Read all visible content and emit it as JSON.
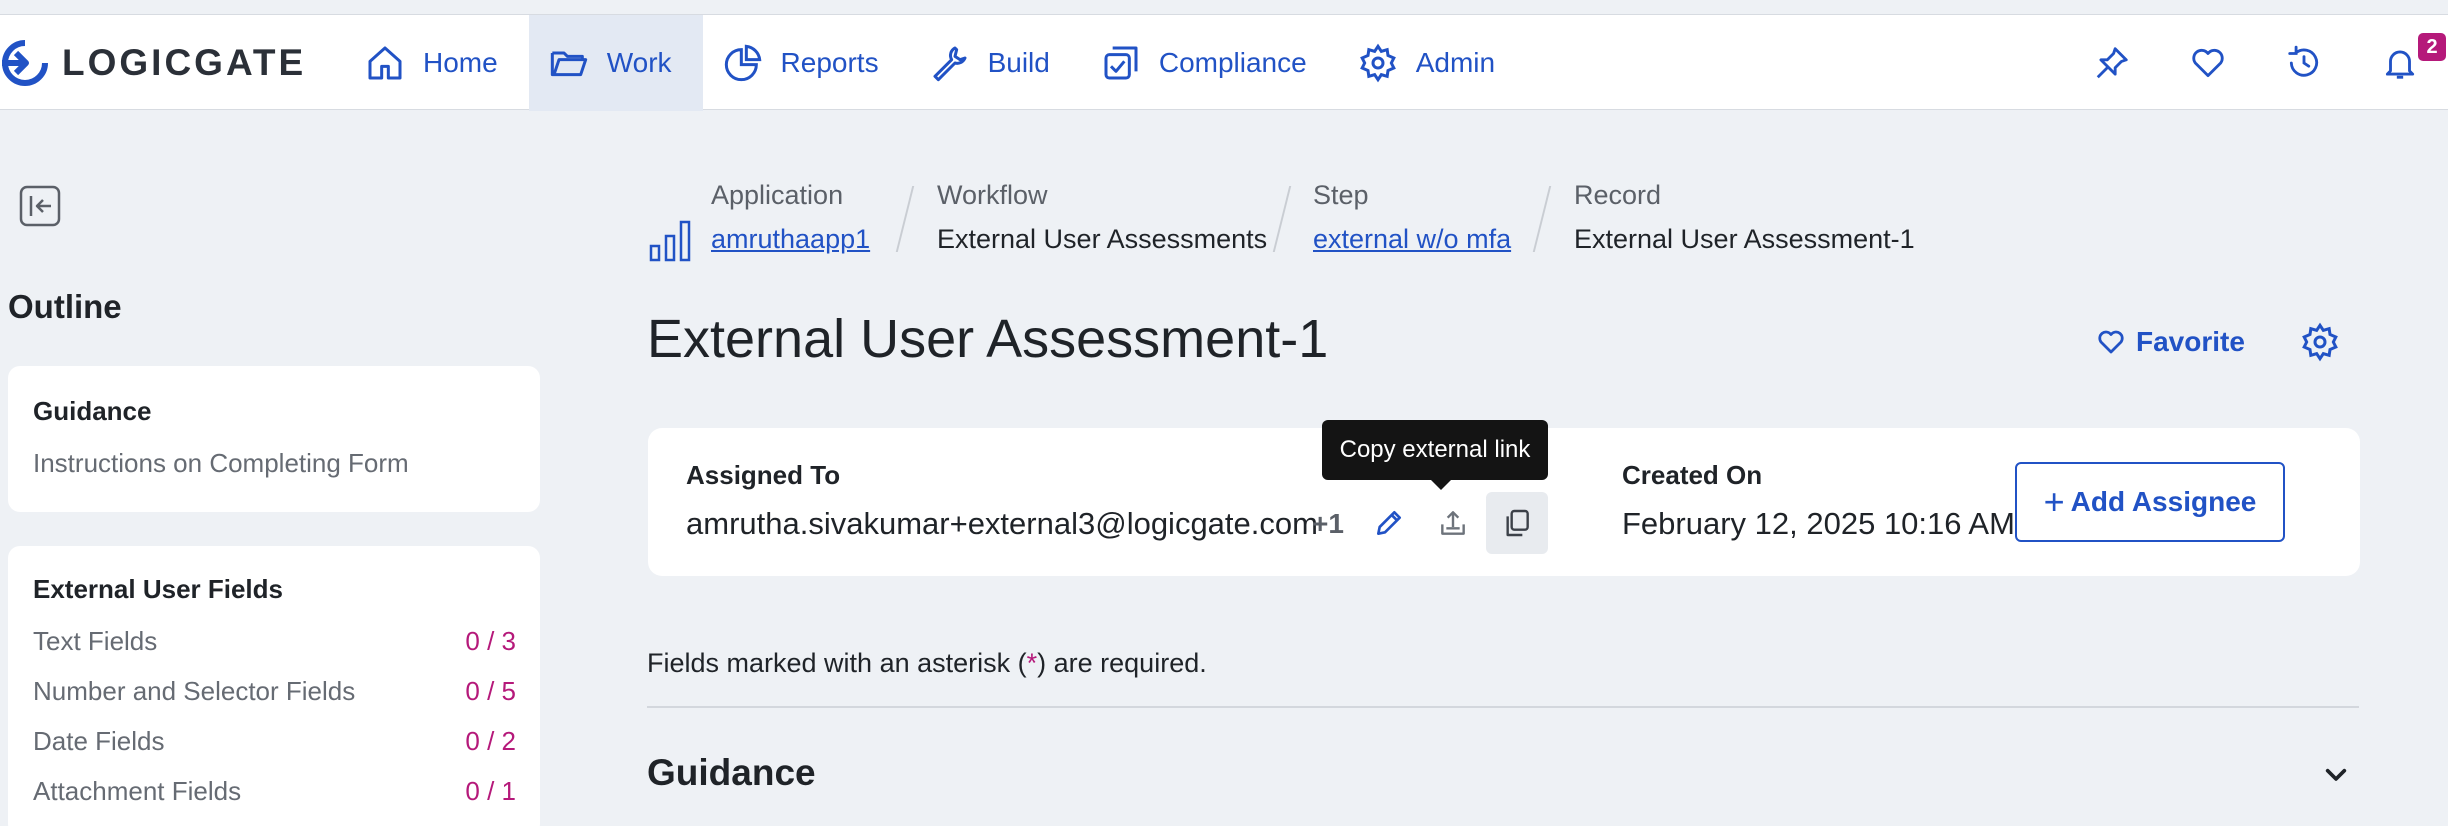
{
  "app": {
    "logo_text": "LOGICGATE"
  },
  "nav": {
    "items": [
      {
        "label": "Home",
        "icon": "home-icon"
      },
      {
        "label": "Work",
        "icon": "folder-icon",
        "active": true
      },
      {
        "label": "Reports",
        "icon": "pie-chart-icon"
      },
      {
        "label": "Build",
        "icon": "wrench-icon"
      },
      {
        "label": "Compliance",
        "icon": "checklist-icon"
      },
      {
        "label": "Admin",
        "icon": "gear-icon"
      }
    ],
    "right_icons": [
      "pin-icon",
      "heart-icon",
      "history-icon",
      "bell-icon"
    ],
    "notification_count": "2"
  },
  "sidebar": {
    "outline_title": "Outline",
    "guidance": {
      "title": "Guidance",
      "subtitle": "Instructions on Completing Form"
    },
    "fields_section": {
      "title": "External User Fields",
      "rows": [
        {
          "label": "Text Fields",
          "count": "0 / 3"
        },
        {
          "label": "Number and Selector Fields",
          "count": "0 / 5"
        },
        {
          "label": "Date Fields",
          "count": "0 / 2"
        },
        {
          "label": "Attachment Fields",
          "count": "0 / 1"
        }
      ]
    }
  },
  "breadcrumb": {
    "application": {
      "label": "Application",
      "value": "amruthaapp1"
    },
    "workflow": {
      "label": "Workflow",
      "value": "External User Assessments"
    },
    "step": {
      "label": "Step",
      "value": "external w/o mfa"
    },
    "record": {
      "label": "Record",
      "value": "External User Assessment-1"
    }
  },
  "record": {
    "title": "External User Assessment-1",
    "favorite_label": "Favorite",
    "assigned_to_label": "Assigned To",
    "assigned_to_value": "amrutha.sivakumar+external3@logicgate.com",
    "assigned_extra": "+1",
    "created_on_label": "Created On",
    "created_on_value": "February 12, 2025 10:16 AM",
    "add_assignee_label": "Add Assignee",
    "tooltip": "Copy external link"
  },
  "form": {
    "required_note_before": "Fields marked with an asterisk (",
    "required_asterisk": "*",
    "required_note_after": ") are required.",
    "section_title": "Guidance"
  },
  "colors": {
    "accent": "#2152c5",
    "magenta": "#b5197a",
    "background": "#eef1f5"
  }
}
